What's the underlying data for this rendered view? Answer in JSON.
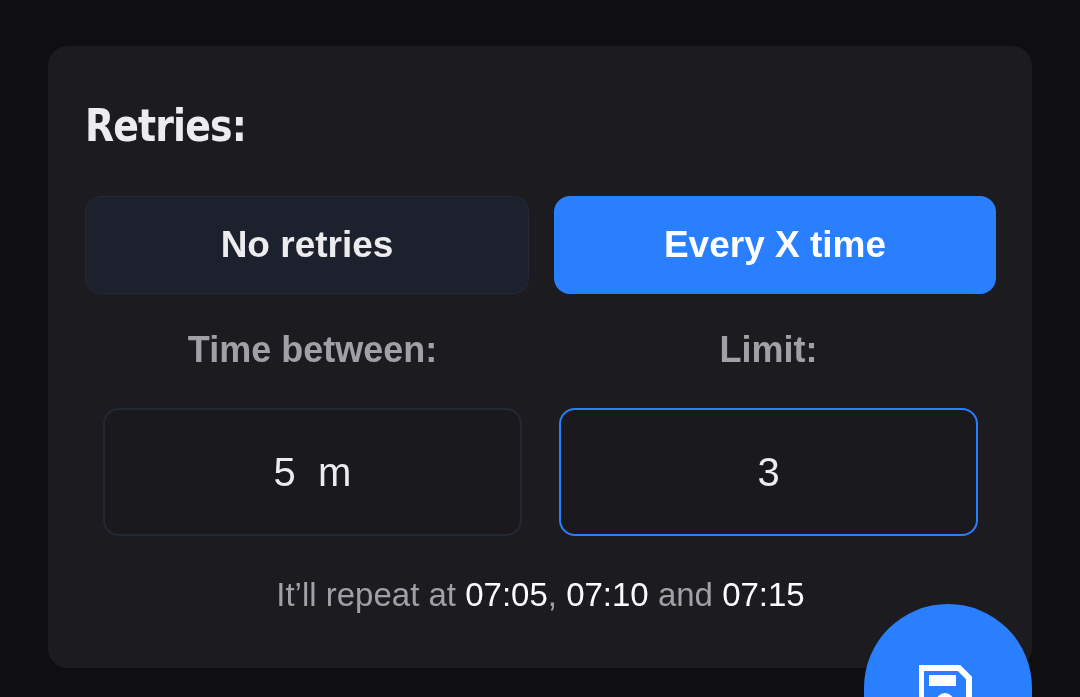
{
  "card": {
    "title": "Retries:"
  },
  "options": [
    {
      "label": "No retries",
      "selected": false
    },
    {
      "label": "Every X time",
      "selected": true
    }
  ],
  "fields": [
    {
      "label": "Time between:",
      "value": "5  m",
      "focused": false
    },
    {
      "label": "Limit:",
      "value": "3",
      "focused": true
    }
  ],
  "summary": [
    {
      "text": "It’ll repeat at ",
      "highlight": false
    },
    {
      "text": "07:05",
      "highlight": true
    },
    {
      "text": ", ",
      "highlight": false
    },
    {
      "text": "07:10",
      "highlight": true
    },
    {
      "text": " and ",
      "highlight": false
    },
    {
      "text": "07:15",
      "highlight": true
    }
  ]
}
